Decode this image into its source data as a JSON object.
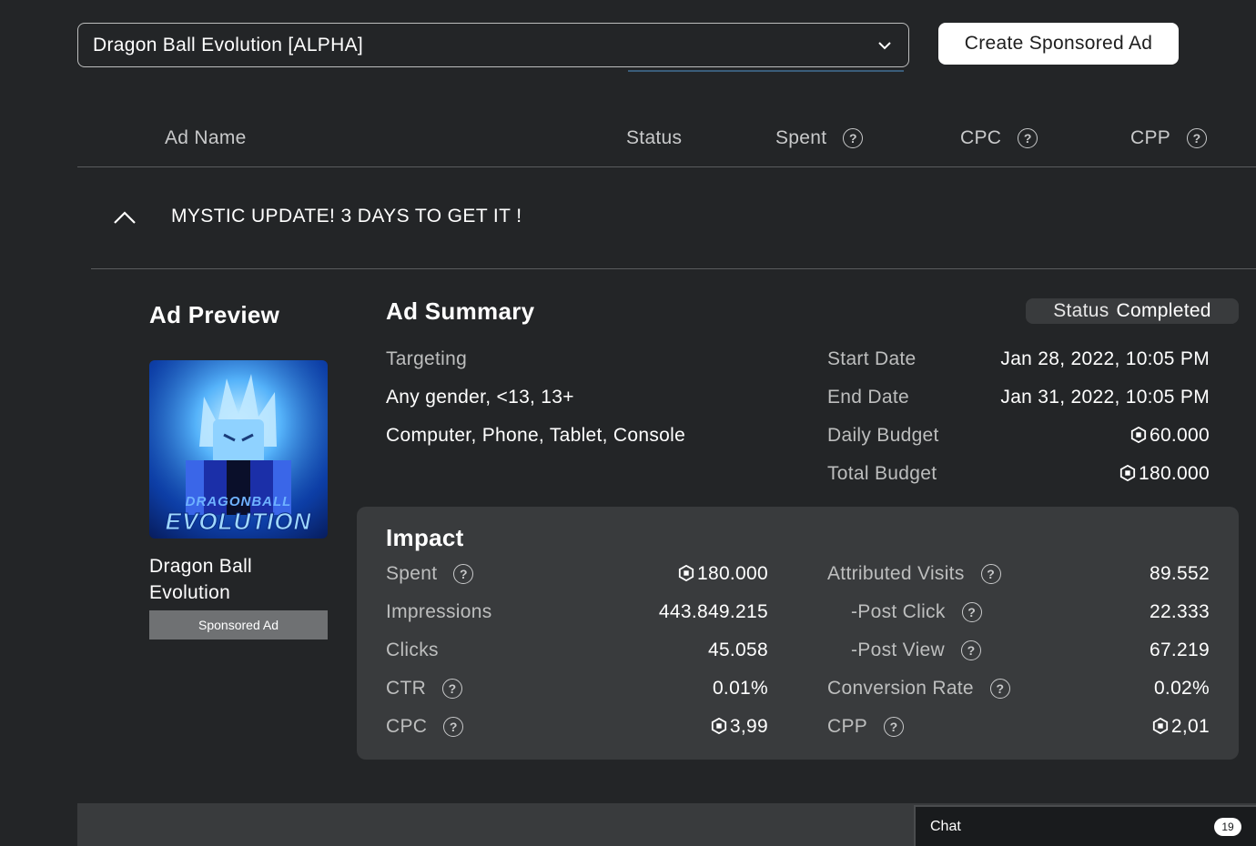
{
  "dropdown": {
    "selected": "Dragon Ball Evolution [ALPHA]"
  },
  "create_button": "Create Sponsored Ad",
  "table_headers": {
    "ad_name": "Ad Name",
    "status": "Status",
    "spent": "Spent",
    "cpc": "CPC",
    "cpp": "CPP"
  },
  "ad_row": {
    "title": "MYSTIC UPDATE! 3 DAYS TO GET IT !"
  },
  "preview": {
    "heading": "Ad Preview",
    "game_name_line1": "Dragon Ball",
    "game_name_line2": "Evolution",
    "badge": "Sponsored Ad",
    "thumbnail_text_top": "DRAGONBALL",
    "thumbnail_text_bottom": "EVOLUTION"
  },
  "summary": {
    "heading": "Ad Summary",
    "status_label": "Status",
    "status_value": "Completed",
    "targeting_label": "Targeting",
    "targeting_audience": "Any gender, <13, 13+",
    "targeting_devices": "Computer, Phone, Tablet, Console",
    "start_date_label": "Start Date",
    "start_date": "Jan 28, 2022, 10:05 PM",
    "end_date_label": "End Date",
    "end_date": "Jan 31, 2022, 10:05 PM",
    "daily_budget_label": "Daily Budget",
    "daily_budget": "60.000",
    "total_budget_label": "Total Budget",
    "total_budget": "180.000"
  },
  "impact": {
    "heading": "Impact",
    "left": [
      {
        "label": "Spent",
        "value": "180.000",
        "help": true,
        "robux": true
      },
      {
        "label": "Impressions",
        "value": "443.849.215",
        "help": false,
        "robux": false
      },
      {
        "label": "Clicks",
        "value": "45.058",
        "help": false,
        "robux": false
      },
      {
        "label": "CTR",
        "value": "0.01%",
        "help": true,
        "robux": false
      },
      {
        "label": "CPC",
        "value": "3,99",
        "help": true,
        "robux": true
      }
    ],
    "right": [
      {
        "label": "Attributed Visits",
        "value": "89.552",
        "help": true,
        "robux": false,
        "indent": false
      },
      {
        "label": "-Post Click",
        "value": "22.333",
        "help": true,
        "robux": false,
        "indent": true
      },
      {
        "label": "-Post View",
        "value": "67.219",
        "help": true,
        "robux": false,
        "indent": true
      },
      {
        "label": "Conversion Rate",
        "value": "0.02%",
        "help": true,
        "robux": false,
        "indent": false
      },
      {
        "label": "CPP",
        "value": "2,01",
        "help": true,
        "robux": true,
        "indent": false
      }
    ]
  },
  "chat": {
    "label": "Chat",
    "count": "19"
  },
  "icons": {
    "dropdown": "chevron-down-icon",
    "collapse": "chevron-up-icon",
    "help": "question-circle-icon",
    "currency": "robux-icon"
  },
  "colors": {
    "background": "#232527",
    "panel": "#393b3d",
    "muted_text": "#bdbebe"
  }
}
